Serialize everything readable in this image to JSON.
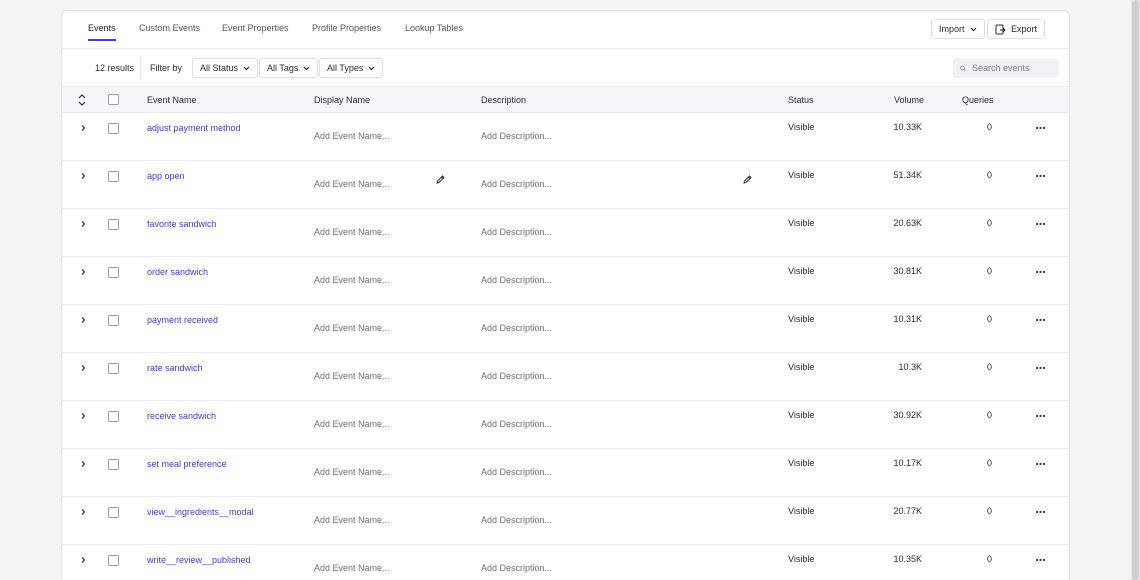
{
  "tabs": [
    {
      "label": "Events",
      "active": true
    },
    {
      "label": "Custom Events",
      "active": false
    },
    {
      "label": "Event Properties",
      "active": false
    },
    {
      "label": "Profile Properties",
      "active": false
    },
    {
      "label": "Lookup Tables",
      "active": false
    }
  ],
  "header": {
    "import_label": "Import",
    "export_label": "Export"
  },
  "filters": {
    "result_count": "12 results",
    "filter_by_label": "Filter by",
    "status_dropdown": "All Status",
    "tags_dropdown": "All Tags",
    "types_dropdown": "All Types"
  },
  "search": {
    "placeholder": "Search events"
  },
  "columns": {
    "event_name": "Event Name",
    "display_name": "Display Name",
    "description": "Description",
    "status": "Status",
    "volume": "Volume",
    "queries": "Queries"
  },
  "rows": [
    {
      "event": "adjust payment method",
      "display": "Add Event Name...",
      "description": "Add Description...",
      "status": "Visible",
      "volume": "10.33K",
      "queries": "0"
    },
    {
      "event": "app open",
      "display": "Add Event Name...",
      "description": "Add Description...",
      "status": "Visible",
      "volume": "51.34K",
      "queries": "0"
    },
    {
      "event": "favorite sandwich",
      "display": "Add Event Name...",
      "description": "Add Description...",
      "status": "Visible",
      "volume": "20.63K",
      "queries": "0"
    },
    {
      "event": "order sandwich",
      "display": "Add Event Name...",
      "description": "Add Description...",
      "status": "Visible",
      "volume": "30.81K",
      "queries": "0"
    },
    {
      "event": "payment received",
      "display": "Add Event Name...",
      "description": "Add Description...",
      "status": "Visible",
      "volume": "10.31K",
      "queries": "0"
    },
    {
      "event": "rate sandwich",
      "display": "Add Event Name...",
      "description": "Add Description...",
      "status": "Visible",
      "volume": "10.3K",
      "queries": "0"
    },
    {
      "event": "receive sandwich",
      "display": "Add Event Name...",
      "description": "Add Description...",
      "status": "Visible",
      "volume": "30.92K",
      "queries": "0"
    },
    {
      "event": "set meal preference",
      "display": "Add Event Name...",
      "description": "Add Description...",
      "status": "Visible",
      "volume": "10.17K",
      "queries": "0"
    },
    {
      "event": "view__ingredients__modal",
      "display": "Add Event Name...",
      "description": "Add Description...",
      "status": "Visible",
      "volume": "20.77K",
      "queries": "0"
    },
    {
      "event": "write__review__published",
      "display": "Add Event Name...",
      "description": "Add Description...",
      "status": "Visible",
      "volume": "10.35K",
      "queries": "0"
    }
  ],
  "icons": {
    "sort": "sort-icon",
    "chevron_down": "chevron-down-icon",
    "chevron_right": "chevron-right-icon",
    "export": "export-icon",
    "search": "search-icon",
    "pencil": "pencil-icon",
    "more": "more-icon"
  },
  "colors": {
    "accent": "#3d3dd6",
    "link": "#3f3fc7"
  }
}
